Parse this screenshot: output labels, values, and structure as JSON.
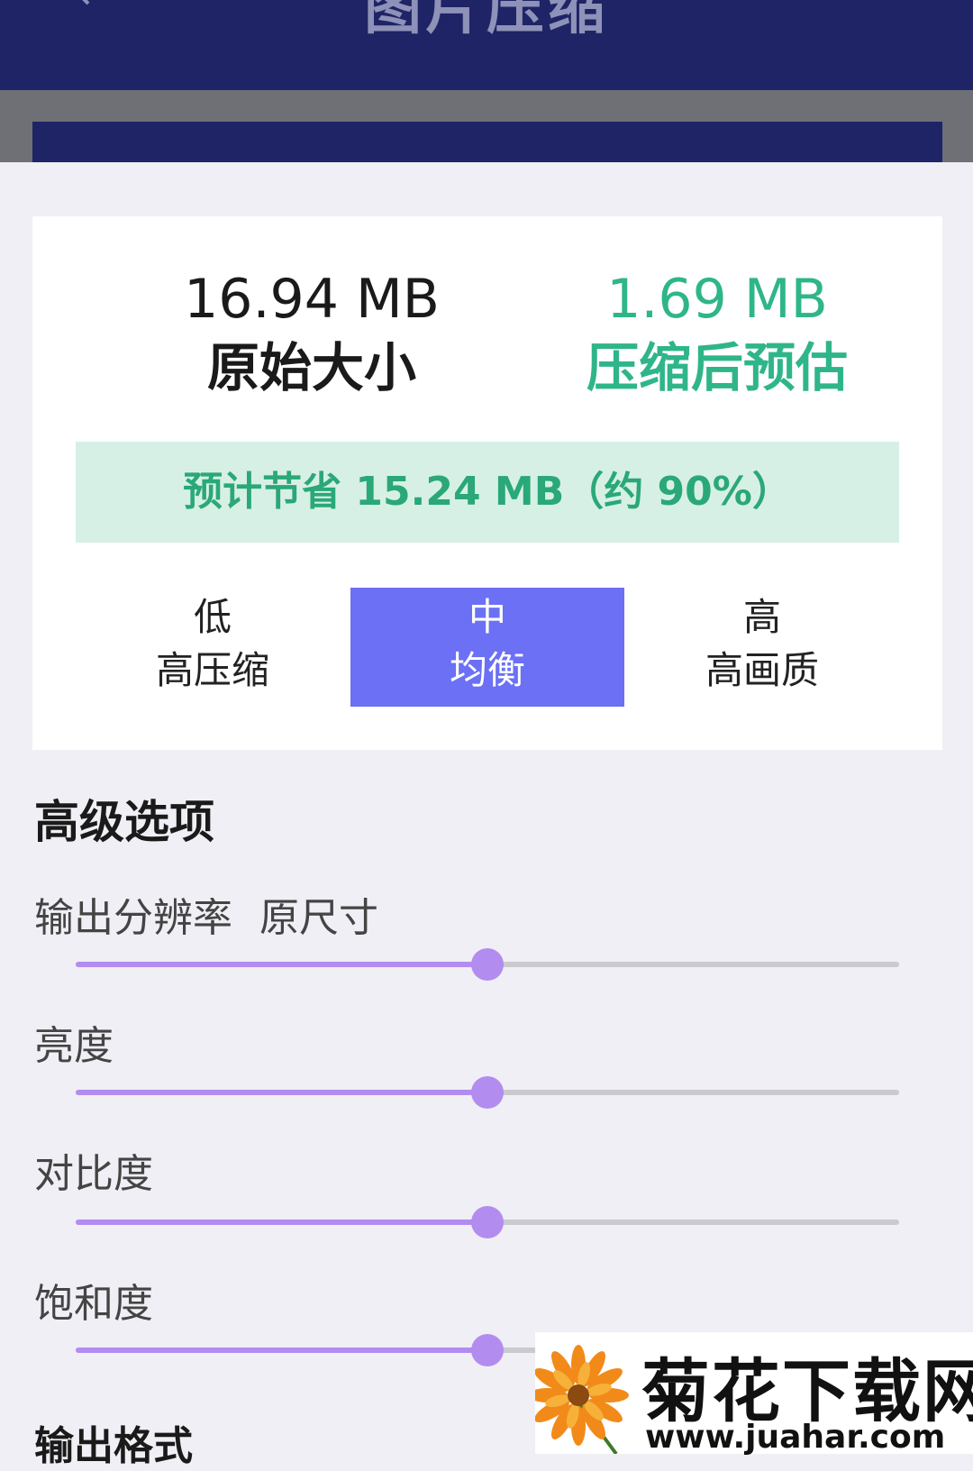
{
  "app_bar": {
    "title": "图片压缩"
  },
  "summary": {
    "original_size": "16.94 MB",
    "original_label": "原始大小",
    "estimated_size": "1.69 MB",
    "estimated_label": "压缩后预估",
    "savings_text": "预计节省 15.24 MB（约 90%）"
  },
  "quality_options": [
    {
      "level": "低",
      "desc": "高压缩",
      "selected": false
    },
    {
      "level": "中",
      "desc": "均衡",
      "selected": true
    },
    {
      "level": "高",
      "desc": "高画质",
      "selected": false
    }
  ],
  "advanced": {
    "title": "高级选项",
    "sliders": [
      {
        "label": "输出分辨率",
        "value": "原尺寸",
        "fraction": 0.5
      },
      {
        "label": "亮度",
        "value": "",
        "fraction": 0.5
      },
      {
        "label": "对比度",
        "value": "",
        "fraction": 0.5
      },
      {
        "label": "饱和度",
        "value": "",
        "fraction": 0.5
      }
    ],
    "output_format_label": "输出格式"
  },
  "colors": {
    "app_bar": "#1e2466",
    "accent": "#6b70f5",
    "savings_green": "#2fb58a",
    "slider": "#b38cf0"
  },
  "watermark": {
    "text": "菊花下载网",
    "url": "www.juahar.com"
  }
}
